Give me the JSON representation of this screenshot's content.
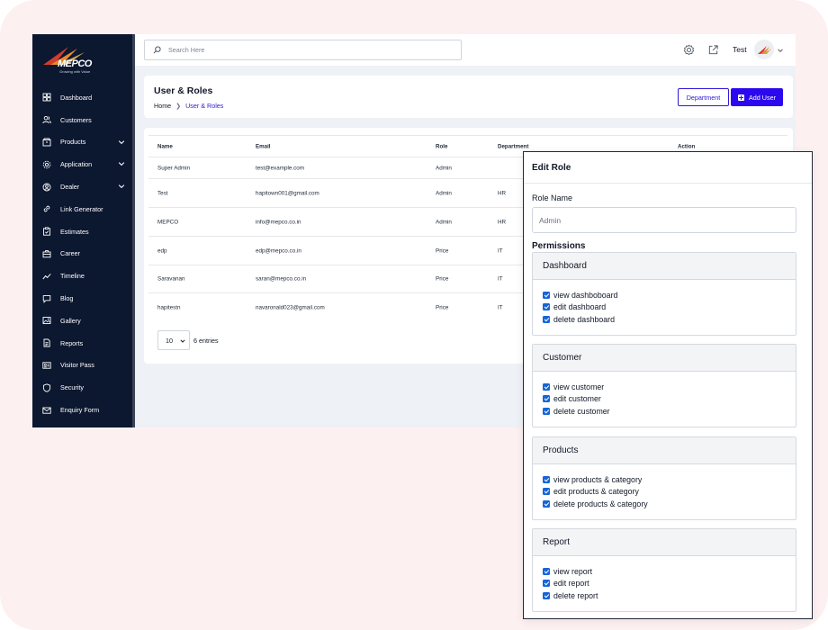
{
  "brand": {
    "logo_text": "MEPCO",
    "tagline": "Growing with Value"
  },
  "sidebar": {
    "items": [
      {
        "label": "Dashboard",
        "icon": "grid-icon",
        "has_chevron": false
      },
      {
        "label": "Customers",
        "icon": "users-icon",
        "has_chevron": false
      },
      {
        "label": "Products",
        "icon": "box-icon",
        "has_chevron": true
      },
      {
        "label": "Application",
        "icon": "gear-icon",
        "has_chevron": true
      },
      {
        "label": "Dealer",
        "icon": "person-circle-icon",
        "has_chevron": true
      },
      {
        "label": "Link Generator",
        "icon": "link-icon",
        "has_chevron": false
      },
      {
        "label": "Estimates",
        "icon": "clipboard-check-icon",
        "has_chevron": false
      },
      {
        "label": "Career",
        "icon": "briefcase-icon",
        "has_chevron": false
      },
      {
        "label": "Timeline",
        "icon": "trend-icon",
        "has_chevron": false
      },
      {
        "label": "Blog",
        "icon": "chat-icon",
        "has_chevron": false
      },
      {
        "label": "Gallery",
        "icon": "image-icon",
        "has_chevron": false
      },
      {
        "label": "Reports",
        "icon": "report-icon",
        "has_chevron": false
      },
      {
        "label": "Visitor Pass",
        "icon": "id-card-icon",
        "has_chevron": false
      },
      {
        "label": "Security",
        "icon": "shield-icon",
        "has_chevron": false
      },
      {
        "label": "Enquiry Form",
        "icon": "mail-icon",
        "has_chevron": false
      }
    ]
  },
  "topbar": {
    "search_placeholder": "Search Here",
    "user_name": "Test"
  },
  "header": {
    "title": "User & Roles",
    "breadcrumb": {
      "home": "Home",
      "current": "User & Roles"
    },
    "department_button": "Department",
    "add_user_button": "Add User"
  },
  "table": {
    "columns": {
      "name": "Name",
      "email": "Email",
      "role": "Role",
      "department": "Department",
      "action": "Action"
    },
    "rows": [
      {
        "name": "Super Admin",
        "email": "test@example.com",
        "role": "Admin",
        "department": ""
      },
      {
        "name": "Test",
        "email": "hapitown001@gmail.com",
        "role": "Admin",
        "department": "HR"
      },
      {
        "name": "MEPCO",
        "email": "info@mepco.co.in",
        "role": "Admin",
        "department": "HR"
      },
      {
        "name": "edp",
        "email": "edp@mepco.co.in",
        "role": "Price",
        "department": "IT"
      },
      {
        "name": "Saravanan",
        "email": "saran@mepco.co.in",
        "role": "Price",
        "department": "IT"
      },
      {
        "name": "hapitestn",
        "email": "navaronald023@gmail.com",
        "role": "Price",
        "department": "IT"
      }
    ],
    "page_size": "10",
    "entries_text": "6 entries"
  },
  "modal": {
    "title": "Edit Role",
    "role_name_label": "Role Name",
    "role_name_value": "Admin",
    "permissions_label": "Permissions",
    "groups": [
      {
        "title": "Dashboard",
        "items": [
          "view dashboboard",
          "edit dashboard",
          "delete dashboard"
        ]
      },
      {
        "title": "Customer",
        "items": [
          "view customer",
          "edit customer",
          "delete customer"
        ]
      },
      {
        "title": "Products",
        "items": [
          "view products & category",
          "edit products & category",
          "delete products & category"
        ]
      },
      {
        "title": "Report",
        "items": [
          "view report",
          "edit report",
          "delete report"
        ]
      }
    ]
  },
  "colors": {
    "sidebar_bg": "#0c1730",
    "accent": "#2c08ee",
    "checkbox": "#1665d8",
    "page_bg": "#fdf0f1"
  }
}
